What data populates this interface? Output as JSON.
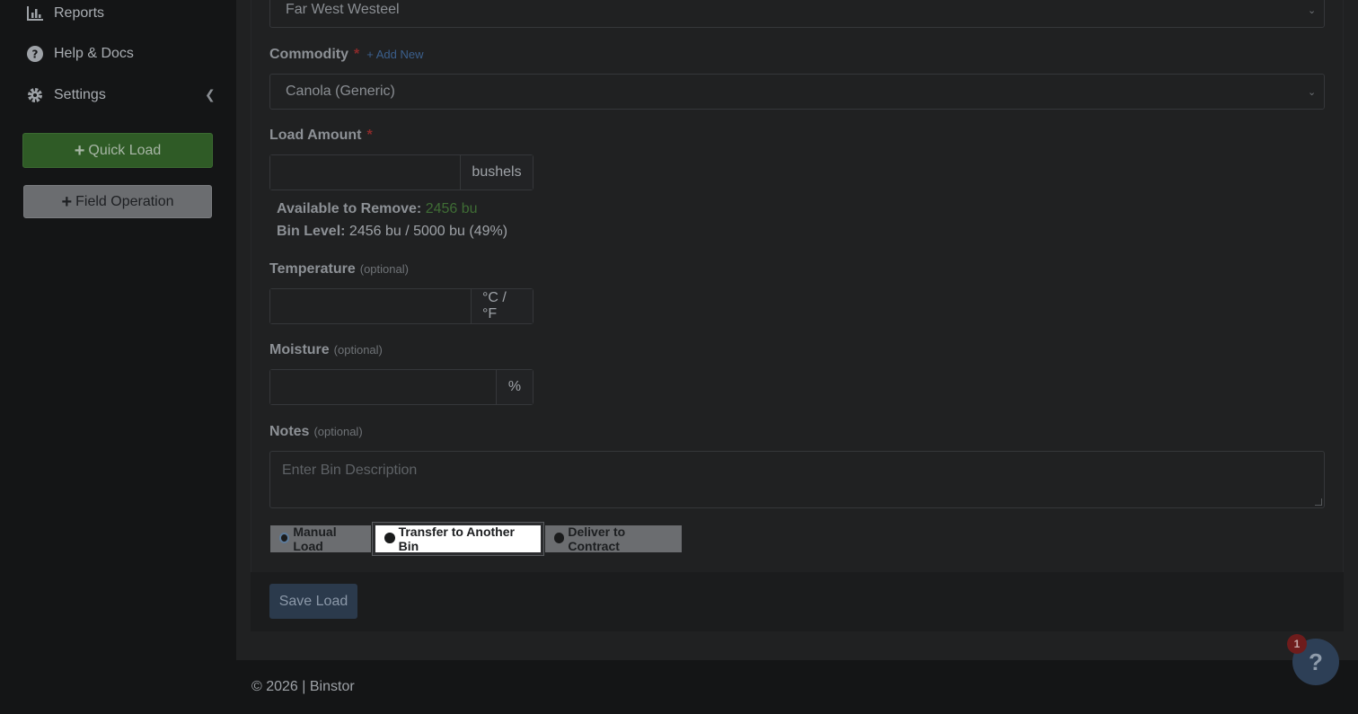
{
  "sidebar": {
    "items": [
      {
        "label": "Reports",
        "icon": "chart-bar-icon"
      },
      {
        "label": "Help & Docs",
        "icon": "question-circle-icon"
      },
      {
        "label": "Settings",
        "icon": "gear-icon"
      }
    ],
    "quick_load_label": "Quick Load",
    "field_operation_label": "Field Operation"
  },
  "form": {
    "bin_select_value": "Far West Westeel",
    "commodity": {
      "label": "Commodity",
      "required_mark": "*",
      "add_new": "+ Add New",
      "value": "Canola (Generic)"
    },
    "load_amount": {
      "label": "Load Amount",
      "required_mark": "*",
      "unit": "bushels"
    },
    "available": {
      "label": "Available to Remove:",
      "value": "2456 bu"
    },
    "bin_level": {
      "label": "Bin Level:",
      "value": "2456 bu / 5000 bu (49%)"
    },
    "temperature": {
      "label": "Temperature",
      "optional": "(optional)",
      "unit": "°C / °F"
    },
    "moisture": {
      "label": "Moisture",
      "optional": "(optional)",
      "unit": "%"
    },
    "notes": {
      "label": "Notes",
      "optional": "(optional)",
      "placeholder": "Enter Bin Description"
    },
    "load_types": [
      {
        "label": "Manual Load"
      },
      {
        "label": "Transfer to Another Bin"
      },
      {
        "label": "Deliver to Contract"
      }
    ],
    "save_label": "Save Load"
  },
  "footer": {
    "text": "© 2026 | Binstor"
  },
  "help_widget": {
    "symbol": "?",
    "badge_count": "1"
  }
}
